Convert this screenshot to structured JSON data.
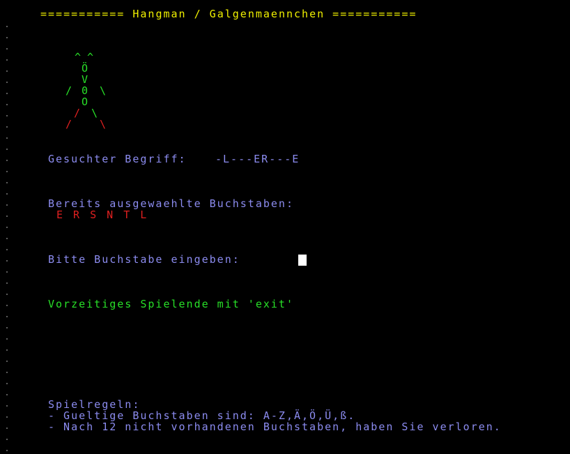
{
  "title": "=========== Hangman / Galgenmaennchen ===========",
  "hangman": {
    "antennae": "^ ^",
    "head": "Ö",
    "neck": "V",
    "arm_left": "/",
    "torso_upper": "0",
    "arm_right": "\\",
    "torso_lower": "O",
    "leg_left_upper": "/",
    "leg_right_upper": "\\",
    "leg_left_lower": "/",
    "leg_right_lower": "\\"
  },
  "search": {
    "label": "Gesuchter Begriff:",
    "pattern": "-L---ER---E"
  },
  "guessed": {
    "label": "Bereits ausgewaehlte Buchstaben:",
    "letters": "E R S N T L"
  },
  "prompt": {
    "label": "Bitte Buchstabe eingeben:"
  },
  "exit_hint": "Vorzeitiges Spielende mit 'exit'",
  "rules": {
    "heading": "Spielregeln:",
    "line1": "- Gueltige Buchstaben sind: A-Z,Ä,Ö,Ü,ß.",
    "line2": "- Nach 12 nicht vorhandenen Buchstaben, haben Sie verloren."
  },
  "colors": {
    "title": "#f0f000",
    "figure_alive": "#28e028",
    "figure_lost": "#e02020",
    "text": "#8c8cf0",
    "hint": "#28e028",
    "guessed": "#e02020",
    "background": "#000000"
  }
}
